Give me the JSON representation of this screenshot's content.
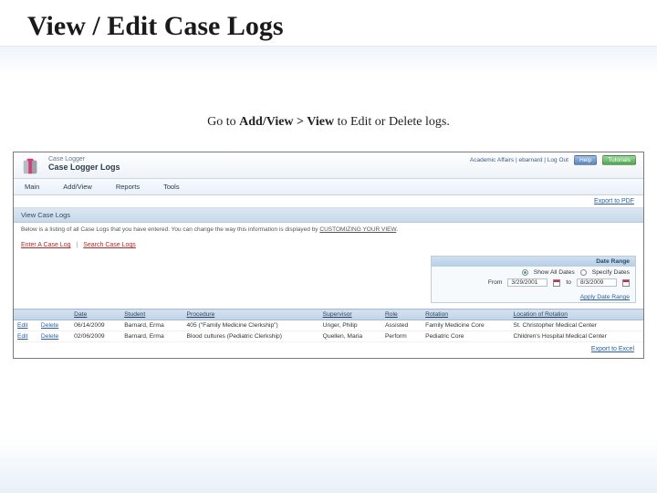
{
  "slide": {
    "title": "View / Edit Case Logs",
    "instruction_pre": "Go to ",
    "instruction_bold": "Add/View > View",
    "instruction_post": " to Edit or Delete logs."
  },
  "app": {
    "product": "Case Logger",
    "page_title": "Case Logger Logs",
    "user_area": {
      "text": "Academic Affairs | ebarnard | ",
      "logout": "Log Out",
      "help": "Help",
      "tutorials": "Tutorials"
    },
    "nav": [
      "Main",
      "Add/View",
      "Reports",
      "Tools"
    ],
    "export_top": "Export to PDF",
    "section_header": "View Case Logs",
    "section_desc_pre": "Below is a listing of all Case Logs that you have entered. You can change the way this information is displayed by ",
    "section_desc_link": "CUSTOMIZING YOUR VIEW",
    "enter_link": "Enter A Case Log",
    "search_link": "Search Case Logs",
    "date_range": {
      "header": "Date Range",
      "show_all": "Show All Dates",
      "specify": "Specify Dates",
      "from_label": "From",
      "from_value": "3/29/2001",
      "to_label": "to",
      "to_value": "8/3/2009",
      "apply": "Apply Date Range"
    },
    "table": {
      "headers": [
        "",
        "",
        "Date",
        "Student",
        "Procedure",
        "Supervisor",
        "Role",
        "Rotation",
        "Location of Rotation"
      ],
      "rows": [
        {
          "edit": "Edit",
          "delete": "Delete",
          "date": "06/14/2009",
          "student": "Barnard, Erma",
          "procedure": "405 (\"Family Medicine Clerkship\")",
          "supervisor": "Unger, Philip",
          "role": "Assisted",
          "rotation": "Family Medicine Core",
          "location": "St. Christopher Medical Center"
        },
        {
          "edit": "Edit",
          "delete": "Delete",
          "date": "02/06/2009",
          "student": "Barnard, Erma",
          "procedure": "Blood cultures (Pediatric Clerkship)",
          "supervisor": "Quellen, Maria",
          "role": "Perform",
          "rotation": "Pediatric Core",
          "location": "Children's Hospital Medical Center"
        }
      ]
    },
    "export_bottom": "Export to Excel"
  }
}
